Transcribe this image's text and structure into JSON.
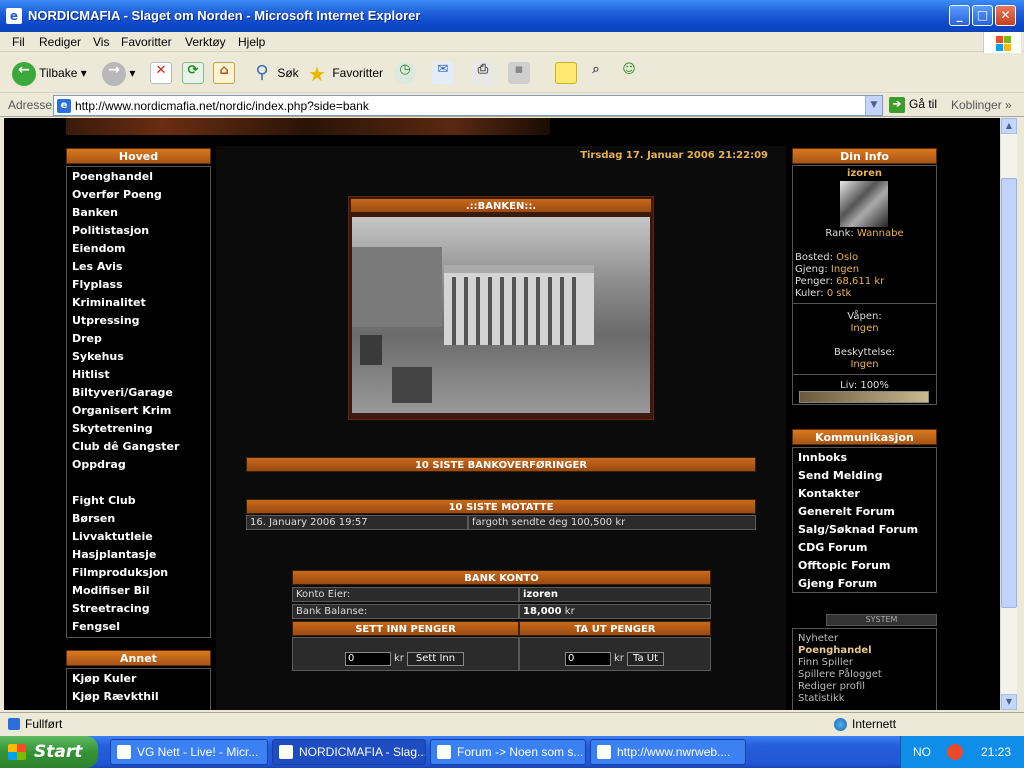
{
  "window": {
    "title": "NORDICMAFIA - Slaget om Norden - Microsoft Internet Explorer",
    "min": "_",
    "max": "□",
    "close": "✕"
  },
  "menu": [
    "Fil",
    "Rediger",
    "Vis",
    "Favoritter",
    "Verktøy",
    "Hjelp"
  ],
  "toolbar": {
    "back": "Tilbake",
    "search": "Søk",
    "favorites": "Favoritter"
  },
  "address": {
    "label": "Adresse",
    "url": "http://www.nordicmafia.net/nordic/index.php?side=bank",
    "go": "Gå til",
    "links": "Koblinger"
  },
  "left": {
    "main_title": "Hoved",
    "main_items": [
      "Poenghandel",
      "Overfør Poeng",
      "Banken",
      "Politistasjon",
      "Eiendom",
      "Les Avis",
      "Flyplass",
      "Kriminalitet",
      "Utpressing",
      "Drep",
      "Sykehus",
      "Hitlist",
      "Biltyveri/Garage",
      "Organisert Krim",
      "Skytetrening",
      "Club dê Gangster",
      "Oppdrag"
    ],
    "main_items2": [
      "Fight Club",
      "Børsen",
      "Livvaktutleie",
      "Hasjplantasje",
      "Filmproduksjon",
      "Modifiser Bil",
      "Streetracing",
      "Fengsel"
    ],
    "other_title": "Annet",
    "other_items": [
      "Kjøp Kuler",
      "Kjøp Rævkthil"
    ]
  },
  "center": {
    "datetime": "Tirsdag 17. Januar 2006 21:22:09",
    "bank_title": ".::BANKEN::.",
    "transfers_title": "10 SISTE BANKOVERFØRINGER",
    "received_title": "10 SISTE MOTATTE",
    "received_rows": [
      {
        "date": "16. January 2006 19:57",
        "text": "fargoth sendte deg 100,500 kr"
      }
    ],
    "account_title": "BANK KONTO",
    "owner_label": "Konto Eier:",
    "owner_value": "izoren",
    "balance_label": "Bank Balanse:",
    "balance_value": "18,000",
    "balance_unit": "kr",
    "deposit_title": "SETT INN PENGER",
    "withdraw_title": "TA UT PENGER",
    "deposit_value": "0",
    "withdraw_value": "0",
    "kr": "kr",
    "deposit_btn": "Sett Inn",
    "withdraw_btn": "Ta Ut"
  },
  "right": {
    "info_title": "Din Info",
    "username": "izoren",
    "rank_label": "Rank:",
    "rank_value": "Wannabe",
    "bosted_label": "Bosted:",
    "bosted_value": "Oslo",
    "gjeng_label": "Gjeng:",
    "gjeng_value": "Ingen",
    "penger_label": "Penger:",
    "penger_value": "68,611 kr",
    "kuler_label": "Kuler:",
    "kuler_value": "0 stk",
    "vapen_label": "Våpen:",
    "vapen_value": "Ingen",
    "beskyttelse_label": "Beskyttelse:",
    "beskyttelse_value": "Ingen",
    "liv_label": "Liv: 100%",
    "liv_fraction": 1.0,
    "comm_title": "Kommunikasjon",
    "comm_items": [
      "Innboks",
      "Send Melding",
      "Kontakter",
      "Generelt Forum",
      "Salg/Søknad Forum",
      "CDG Forum",
      "Offtopic Forum",
      "Gjeng Forum"
    ],
    "system_title": "SYSTEM",
    "system_items": [
      "Nyheter",
      "Poenghandel",
      "Finn Spiller",
      "Spillere Pålogget",
      "Rediger profil",
      "Statistikk"
    ]
  },
  "status": {
    "text": "Fullført",
    "zone": "Internett"
  },
  "taskbar": {
    "start": "Start",
    "tasks": [
      "VG Nett - Live! - Micr...",
      "NORDICMAFIA - Slag...",
      "Forum -> Noen som s...",
      "http://www.nwrweb...."
    ],
    "lang": "NO",
    "clock": "21:23"
  }
}
